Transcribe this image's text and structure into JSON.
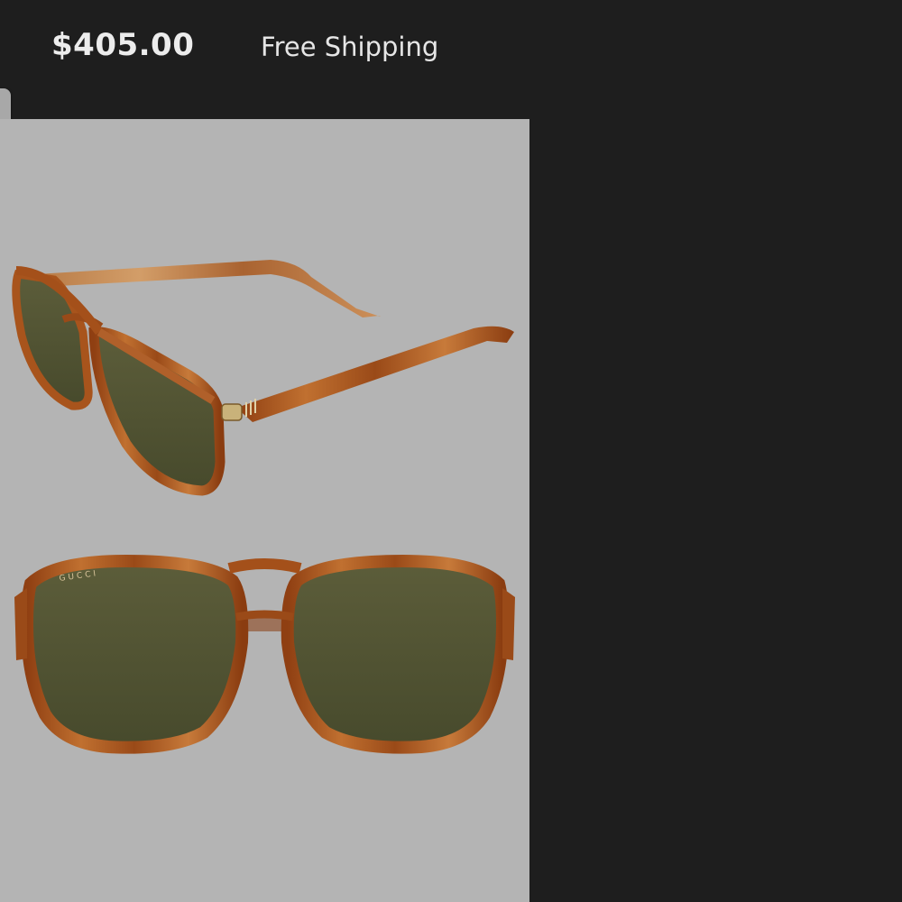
{
  "header": {
    "price": "$405.00",
    "shipping": "Free Shipping"
  },
  "product": {
    "image_alt": "Tortoiseshell aviator sunglasses with green lenses, side and front views",
    "brand_mark": "GUCCI",
    "colors": {
      "panel_background": "#b4b4b4",
      "frame_tortoise": "#a8541c",
      "lens_green": "#4f5232",
      "page_background": "#1e1e1e"
    }
  }
}
